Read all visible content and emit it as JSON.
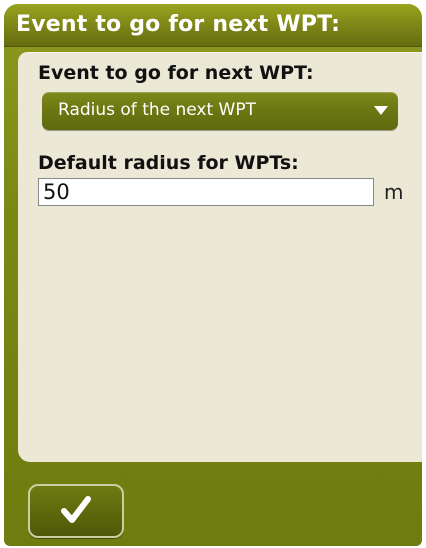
{
  "window": {
    "title": "Event to go for next WPT:"
  },
  "form": {
    "event_label": "Event to go for next WPT:",
    "event_selected": "Radius of the next WPT",
    "radius_label": "Default radius for WPTs:",
    "radius_value": "50",
    "radius_unit": "m"
  },
  "actions": {
    "confirm_icon": "checkmark-icon"
  },
  "colors": {
    "olive": "#7a8814",
    "panel": "#ebe8d6",
    "text": "#111111",
    "white": "#ffffff"
  }
}
